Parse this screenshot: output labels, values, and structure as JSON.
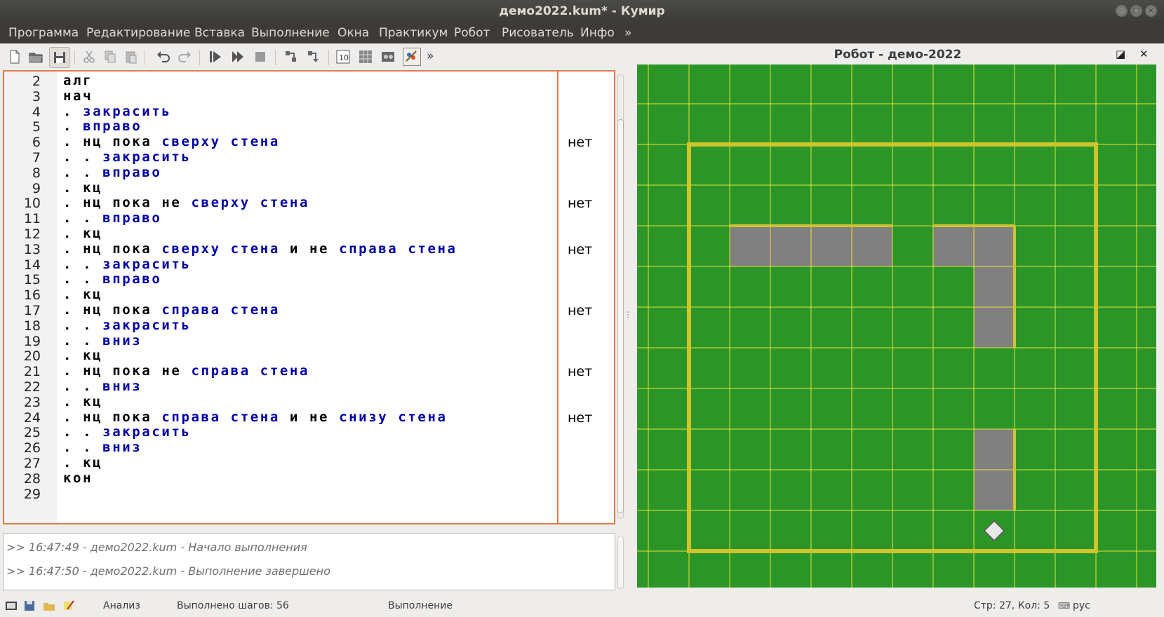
{
  "window": {
    "title": "демо2022.kum* - Кумир"
  },
  "menu": [
    "Программа",
    "Редактирование",
    "Вставка",
    "Выполнение",
    "Окна",
    "Практикум",
    "Робот",
    "Рисователь",
    "Инфо",
    "»"
  ],
  "toolbar": {
    "more_label": "»"
  },
  "editor": {
    "lines": [
      {
        "n": "2",
        "parts": [
          [
            "k",
            "алг"
          ]
        ],
        "margin": ""
      },
      {
        "n": "3",
        "parts": [
          [
            "k",
            "нач"
          ]
        ],
        "margin": ""
      },
      {
        "n": "4",
        "parts": [
          [
            "k",
            ". "
          ],
          [
            "b",
            "закрасить"
          ]
        ],
        "margin": ""
      },
      {
        "n": "5",
        "parts": [
          [
            "k",
            ". "
          ],
          [
            "b",
            "вправо"
          ]
        ],
        "margin": ""
      },
      {
        "n": "6",
        "parts": [
          [
            "k",
            ". нц пока "
          ],
          [
            "b",
            "сверху стена"
          ]
        ],
        "margin": "нет"
      },
      {
        "n": "7",
        "parts": [
          [
            "k",
            ". . "
          ],
          [
            "b",
            "закрасить"
          ]
        ],
        "margin": ""
      },
      {
        "n": "8",
        "parts": [
          [
            "k",
            ". . "
          ],
          [
            "b",
            "вправо"
          ]
        ],
        "margin": ""
      },
      {
        "n": "9",
        "parts": [
          [
            "k",
            ". кц"
          ]
        ],
        "margin": ""
      },
      {
        "n": "10",
        "parts": [
          [
            "k",
            ". нц пока не "
          ],
          [
            "b",
            "сверху стена"
          ]
        ],
        "margin": "нет"
      },
      {
        "n": "11",
        "parts": [
          [
            "k",
            ". . "
          ],
          [
            "b",
            "вправо"
          ]
        ],
        "margin": ""
      },
      {
        "n": "12",
        "parts": [
          [
            "k",
            ". кц"
          ]
        ],
        "margin": ""
      },
      {
        "n": "13",
        "parts": [
          [
            "k",
            ". нц пока "
          ],
          [
            "b",
            "сверху стена"
          ],
          [
            "k",
            " и не "
          ],
          [
            "b",
            "справа стена"
          ]
        ],
        "margin": "нет"
      },
      {
        "n": "14",
        "parts": [
          [
            "k",
            ". . "
          ],
          [
            "b",
            "закрасить"
          ]
        ],
        "margin": ""
      },
      {
        "n": "15",
        "parts": [
          [
            "k",
            ". . "
          ],
          [
            "b",
            "вправо"
          ]
        ],
        "margin": ""
      },
      {
        "n": "16",
        "parts": [
          [
            "k",
            ". кц"
          ]
        ],
        "margin": ""
      },
      {
        "n": "17",
        "parts": [
          [
            "k",
            ". нц пока "
          ],
          [
            "b",
            "справа стена"
          ]
        ],
        "margin": "нет"
      },
      {
        "n": "18",
        "parts": [
          [
            "k",
            ". . "
          ],
          [
            "b",
            "закрасить"
          ]
        ],
        "margin": ""
      },
      {
        "n": "19",
        "parts": [
          [
            "k",
            ". . "
          ],
          [
            "b",
            "вниз"
          ]
        ],
        "margin": ""
      },
      {
        "n": "20",
        "parts": [
          [
            "k",
            ". кц"
          ]
        ],
        "margin": ""
      },
      {
        "n": "21",
        "parts": [
          [
            "k",
            ". нц пока не "
          ],
          [
            "b",
            "справа стена"
          ]
        ],
        "margin": "нет"
      },
      {
        "n": "22",
        "parts": [
          [
            "k",
            ". . "
          ],
          [
            "b",
            "вниз"
          ]
        ],
        "margin": ""
      },
      {
        "n": "23",
        "parts": [
          [
            "k",
            ". кц"
          ]
        ],
        "margin": ""
      },
      {
        "n": "24",
        "parts": [
          [
            "k",
            ". нц пока "
          ],
          [
            "b",
            "справа стена"
          ],
          [
            "k",
            " и не "
          ],
          [
            "b",
            "снизу стена"
          ]
        ],
        "margin": "нет"
      },
      {
        "n": "25",
        "parts": [
          [
            "k",
            ". . "
          ],
          [
            "b",
            "закрасить"
          ]
        ],
        "margin": ""
      },
      {
        "n": "26",
        "parts": [
          [
            "k",
            ". . "
          ],
          [
            "b",
            "вниз"
          ]
        ],
        "margin": ""
      },
      {
        "n": "27",
        "parts": [
          [
            "k",
            ". кц"
          ]
        ],
        "margin": ""
      },
      {
        "n": "28",
        "parts": [
          [
            "k",
            "кон"
          ]
        ],
        "margin": ""
      },
      {
        "n": "29",
        "parts": [],
        "margin": ""
      }
    ]
  },
  "console": {
    "lines": [
      ">> 16:47:49 - демо2022.kum - Начало выполнения",
      ">> 16:47:50 - демо2022.kum - Выполнение завершено"
    ]
  },
  "robot": {
    "title": "Робот - демо-2022",
    "cols": 12,
    "rows": 12,
    "wall_rect": [
      1,
      1,
      11,
      11
    ],
    "painted": [
      [
        2,
        3
      ],
      [
        3,
        3
      ],
      [
        4,
        3
      ],
      [
        5,
        3
      ],
      [
        7,
        3
      ],
      [
        8,
        3
      ],
      [
        8,
        4
      ],
      [
        8,
        5
      ],
      [
        8,
        8
      ],
      [
        8,
        9
      ]
    ],
    "walls": [
      {
        "r": 3,
        "c1": 2,
        "c2": 6
      },
      {
        "r": 3,
        "c1": 7,
        "c2": 9
      }
    ],
    "vwalls": [
      {
        "c": 9,
        "r1": 3,
        "r2": 6
      },
      {
        "c": 9,
        "r1": 8,
        "r2": 10
      }
    ],
    "robot_pos": [
      8,
      10
    ],
    "colors": {
      "field": "#2b9627",
      "grid": "#e6e23c",
      "wall": "#cfc42c",
      "paint": "#808080"
    }
  },
  "status": {
    "mode": "Анализ",
    "steps": "Выполнено шагов: 56",
    "state": "Выполнение",
    "cursor": "Стр: 27, Кол: 5",
    "lang": "рус"
  }
}
